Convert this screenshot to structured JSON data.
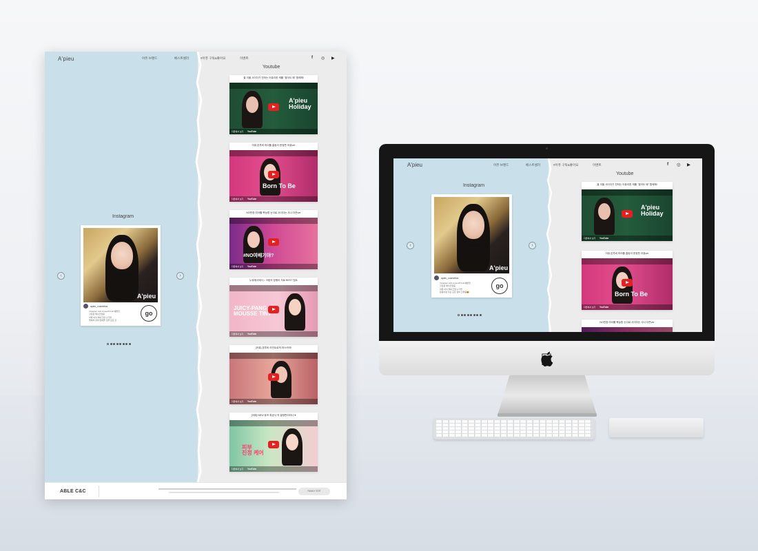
{
  "brand": {
    "logo": "A'pieu"
  },
  "nav": {
    "items": [
      "어퓨 브랜드",
      "베스트셀러",
      "#어퓨 구독&좋아요",
      "이벤트"
    ]
  },
  "social": {
    "facebook": "f",
    "instagram": "◎",
    "youtube": "▶"
  },
  "instagram": {
    "title": "Instagram",
    "handle": "apieu_cosmetics",
    "caption_lines": [
      "Instacam with A'pieu(♥ Full 예쁜컷",
      "할로윈 메이크업용",
      "어퓨 아이 메이크업 나가볼",
      "명예석 장대 없애줄 것을 모든 것",
      "운동이랑 자는 모든 장비 진행중🎃"
    ],
    "photo_brand": "A'pieu",
    "go_label": "go",
    "prev_arrow": "‹",
    "next_arrow": "›",
    "dot_count": 8
  },
  "youtube": {
    "title": "Youtube",
    "mini_label": "다른에서 보기",
    "yt_word": "YouTube",
    "videos": [
      {
        "caption": "올 겨울 사이다가 전하는 어퓨리한 캐롤 \"꽃어도 돼\" 함께해!",
        "thumb_title": "A'pieu\nHoliday",
        "theme": "holiday"
      },
      {
        "caption": "어퓨 본투비 마이틀 홈링이 한정판 어퓨ver",
        "thumb_title": "Born To Be",
        "theme": "born"
      },
      {
        "caption": "NO반창 여아를 복능힘 눈이로 사이다는 사나 더즌ver",
        "thumb_title": "#NO여배기야?",
        "theme": "no"
      },
      {
        "caption": "누워에서에서 ♪ 크림의 창왕이 처로 BEST 립트",
        "thumb_title": "JUICY-PANG\nMOUSSE TINT",
        "theme": "juicy"
      },
      {
        "caption": "[어퓨] 본투비 라인트로의 마스카라!",
        "thumb_title": "",
        "theme": "mascara"
      },
      {
        "caption": "[어퓨] NEW 퓨즈 특공식 의 결정판이라나 ♥",
        "thumb_title": "피부\n진정 케어",
        "theme": "care"
      }
    ]
  },
  "footer": {
    "logo": "ABLE C&C",
    "family_site": "FAMILY SITE"
  },
  "colors": {
    "blue_panel": "#c9dfea",
    "grey_panel": "#ececec",
    "yt_red": "#e52020"
  }
}
